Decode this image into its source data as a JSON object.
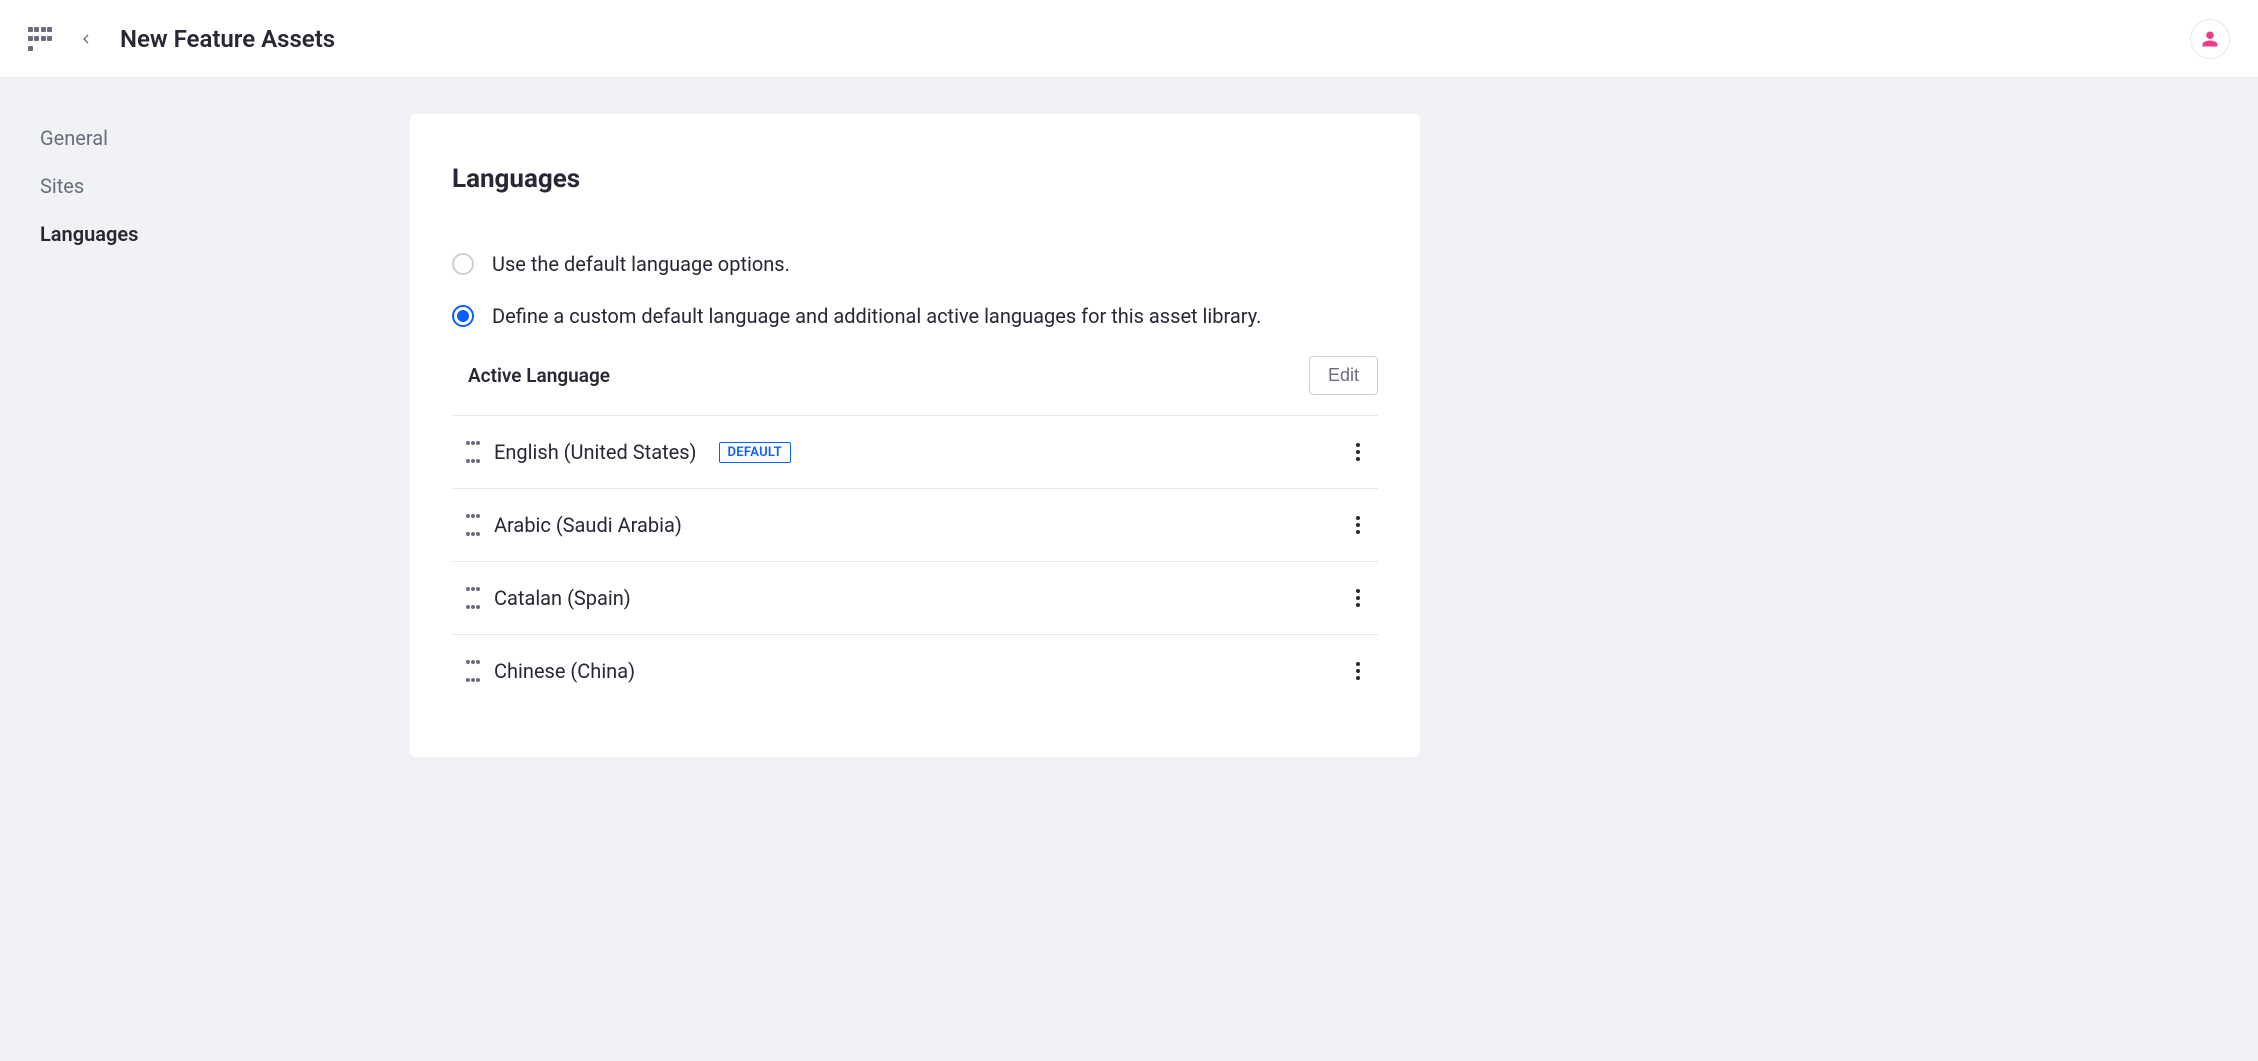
{
  "header": {
    "title": "New Feature Assets"
  },
  "sidebar": {
    "items": [
      {
        "label": "General",
        "active": false
      },
      {
        "label": "Sites",
        "active": false
      },
      {
        "label": "Languages",
        "active": true
      }
    ]
  },
  "panel": {
    "heading": "Languages",
    "options": {
      "use_default": "Use the default language options.",
      "custom": "Define a custom default language and additional active languages for this asset library.",
      "selected": "custom"
    },
    "active_language": {
      "title": "Active Language",
      "edit_label": "Edit",
      "default_badge": "DEFAULT",
      "languages": [
        {
          "name": "English (United States)",
          "is_default": true
        },
        {
          "name": "Arabic (Saudi Arabia)",
          "is_default": false
        },
        {
          "name": "Catalan (Spain)",
          "is_default": false
        },
        {
          "name": "Chinese (China)",
          "is_default": false
        }
      ]
    }
  }
}
